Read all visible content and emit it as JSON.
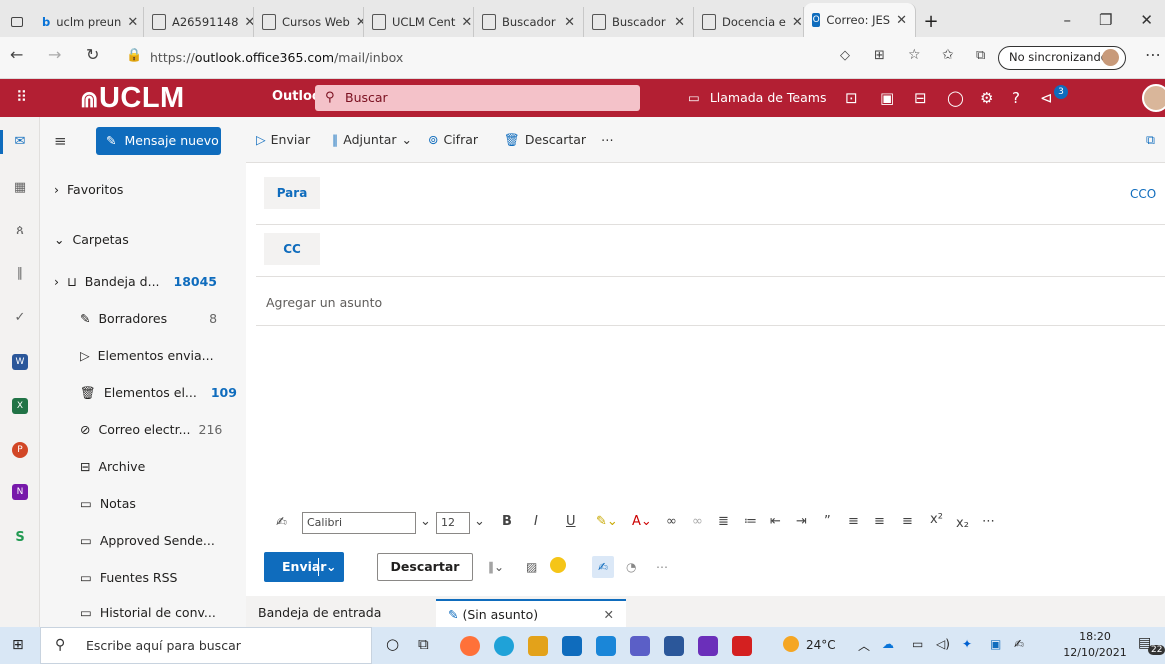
{
  "browser": {
    "tabs": [
      {
        "label": "uclm preun",
        "icon": "bing-icon"
      },
      {
        "label": "A26591148",
        "icon": "page-icon"
      },
      {
        "label": "Cursos Web",
        "icon": "page-icon"
      },
      {
        "label": "UCLM Cent",
        "icon": "page-icon"
      },
      {
        "label": "Buscador",
        "icon": "page-icon"
      },
      {
        "label": "Buscador",
        "icon": "page-icon"
      },
      {
        "label": "Docencia e",
        "icon": "page-icon"
      },
      {
        "label": "Correo: JES",
        "icon": "outlook-icon",
        "active": true
      }
    ],
    "url_prefix": "https://",
    "url_host": "outlook.office365.com",
    "url_path": "/mail/inbox",
    "sync_label": "No sincronizando"
  },
  "header": {
    "logo": "UCLM",
    "app": "Outlook",
    "search_placeholder": "Buscar",
    "teams_label": "Llamada de Teams",
    "notif_count": "3"
  },
  "sidebar": {
    "new_message": "Mensaje nuevo",
    "favorites": "Favoritos",
    "folders_heading": "Carpetas",
    "items": [
      {
        "label": "Bandeja d...",
        "count": "18045",
        "icon": "inbox-icon"
      },
      {
        "label": "Borradores",
        "count": "8",
        "icon": "pencil-icon"
      },
      {
        "label": "Elementos envia...",
        "count": "",
        "icon": "send-icon"
      },
      {
        "label": "Elementos el...",
        "count": "109",
        "icon": "trash-icon"
      },
      {
        "label": "Correo electr...",
        "count": "216",
        "icon": "blocked-icon"
      },
      {
        "label": "Archive",
        "count": "",
        "icon": "archive-icon"
      },
      {
        "label": "Notas",
        "count": "",
        "icon": "note-icon"
      },
      {
        "label": "Approved Sende...",
        "count": "",
        "icon": "folder-icon"
      },
      {
        "label": "Fuentes RSS",
        "count": "",
        "icon": "folder-icon"
      },
      {
        "label": "Historial de conv...",
        "count": "",
        "icon": "folder-icon"
      }
    ]
  },
  "compose": {
    "toolbar": {
      "send": "Enviar",
      "attach": "Adjuntar",
      "encrypt": "Cifrar",
      "discard": "Descartar"
    },
    "to_label": "Para",
    "cc_label": "CC",
    "bcc_label": "CCO",
    "subject_placeholder": "Agregar un asunto",
    "font": "Calibri",
    "font_size": "12",
    "send_button": "Enviar",
    "discard_button": "Descartar"
  },
  "lower_tabs": {
    "inbox": "Bandeja de entrada",
    "draft": "(Sin asunto)"
  },
  "taskbar": {
    "search_placeholder": "Escribe aquí para buscar",
    "weather": "24°C",
    "time": "18:20",
    "date": "12/10/2021",
    "notif_count": "22"
  },
  "colors": {
    "brand": "#b31f33",
    "accent": "#0f6cbd"
  }
}
